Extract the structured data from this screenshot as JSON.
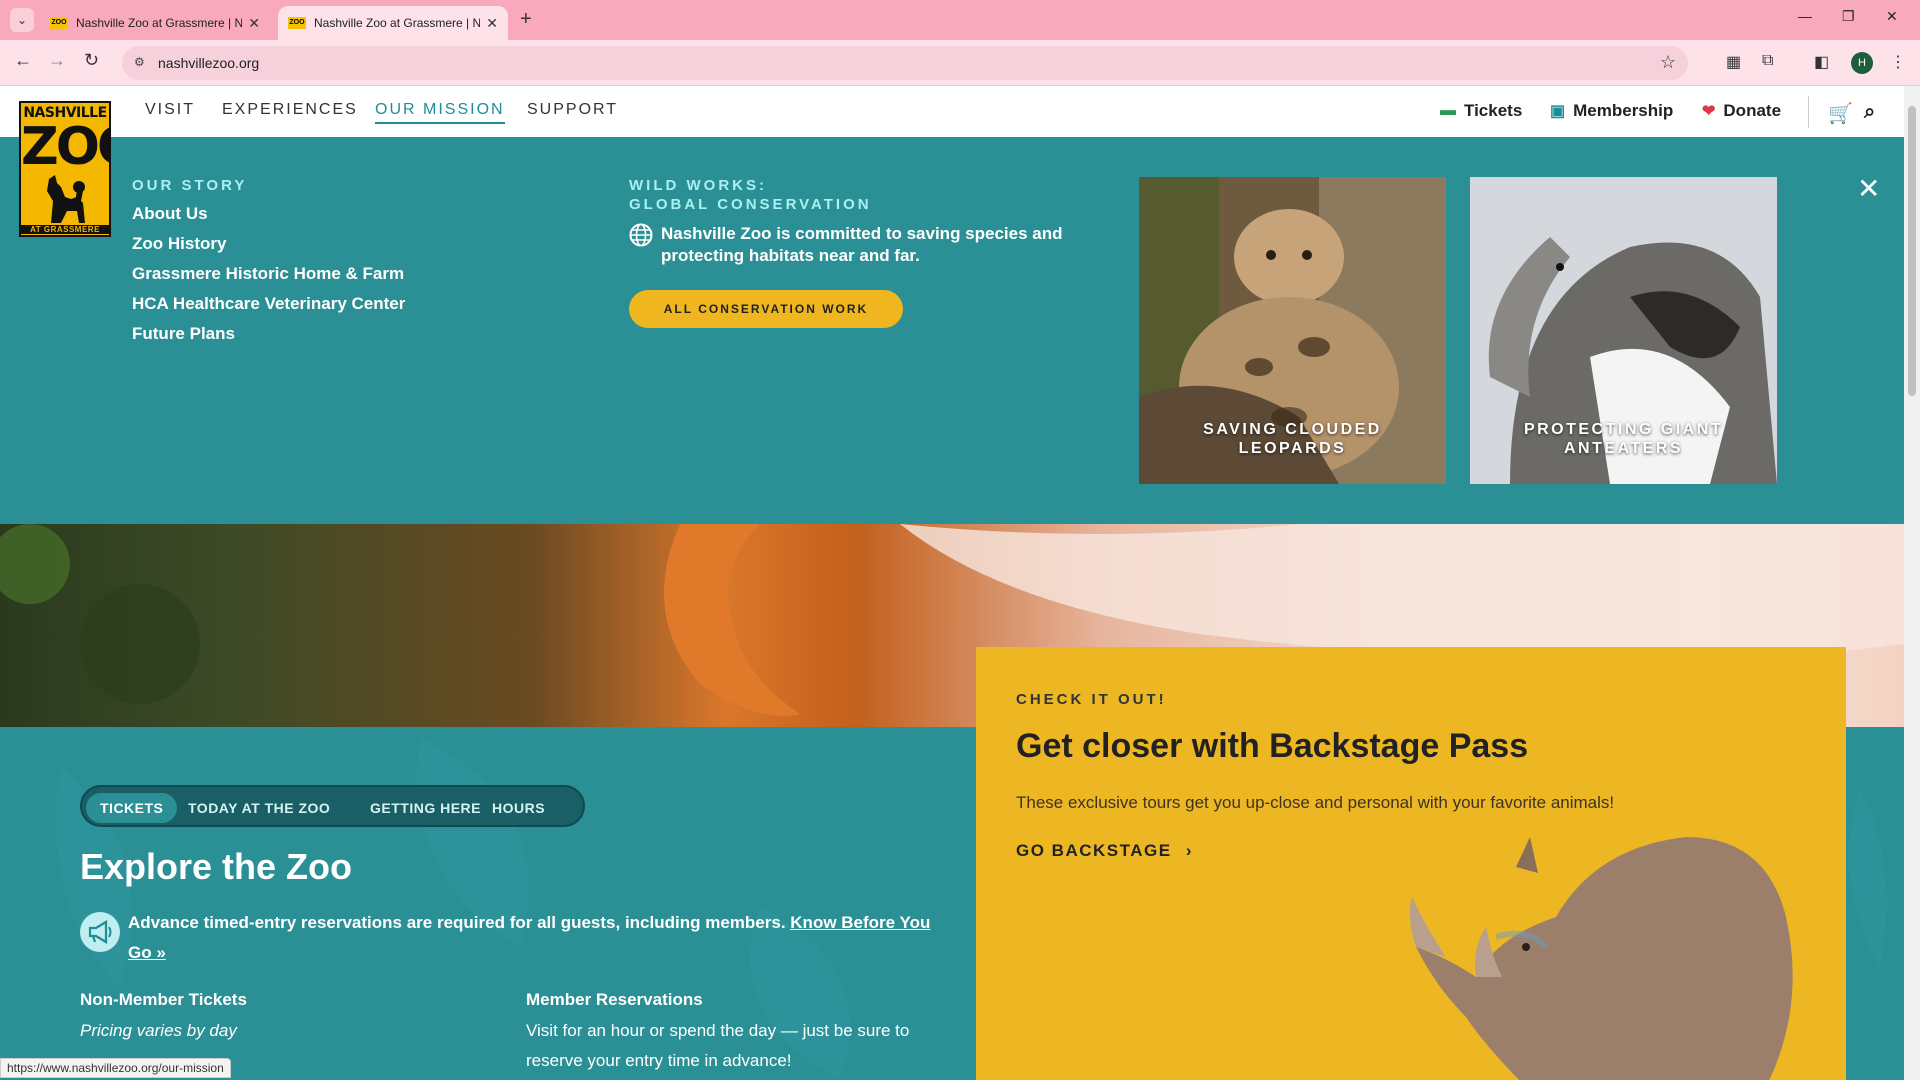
{
  "browser": {
    "tabs": [
      {
        "title": "Nashville Zoo at Grassmere | Na",
        "favicon": "ZOO"
      },
      {
        "title": "Nashville Zoo at Grassmere | Na",
        "favicon": "ZOO"
      }
    ],
    "url": "nashvillezoo.org",
    "profile_initial": "H",
    "status_url": "https://www.nashvillezoo.org/our-mission"
  },
  "logo": {
    "line1": "NASHVILLE",
    "line2": "ZOO",
    "line3": "AT GRASSMERE"
  },
  "nav": {
    "items": [
      "VISIT",
      "EXPERIENCES",
      "OUR MISSION",
      "SUPPORT"
    ],
    "active": "OUR MISSION",
    "tickets": "Tickets",
    "membership": "Membership",
    "donate": "Donate"
  },
  "mega": {
    "story_heading": "OUR STORY",
    "story_links": [
      "About Us",
      "Zoo History",
      "Grassmere Historic Home & Farm",
      "HCA Healthcare Veterinary Center",
      "Future Plans"
    ],
    "wild_heading_1": "WILD WORKS:",
    "wild_heading_2": "GLOBAL CONSERVATION",
    "wild_text": "Nashville Zoo is committed to saving species and protecting habitats near and far.",
    "button": "ALL CONSERVATION WORK",
    "cards": [
      {
        "line1": "SAVING CLOUDED",
        "line2": "LEOPARDS"
      },
      {
        "line1": "PROTECTING GIANT",
        "line2": "ANTEATERS"
      }
    ]
  },
  "content": {
    "pills": [
      "TICKETS",
      "TODAY AT THE ZOO",
      "GETTING HERE",
      "HOURS"
    ],
    "title": "Explore the Zoo",
    "notice": "Advance timed-entry reservations are required for all guests, including members.",
    "notice_link": "Know Before You Go »",
    "col1_heading": "Non-Member Tickets",
    "col1_text": "Pricing varies by day",
    "col2_heading": "Member Reservations",
    "col2_text": "Visit for an hour or spend the day — just be sure to reserve your entry time in advance!"
  },
  "promo": {
    "kicker": "CHECK IT OUT!",
    "title": "Get closer with Backstage Pass",
    "desc": "These exclusive tours get you up-close and personal with your favorite animals!",
    "cta": "GO BACKSTAGE"
  },
  "colors": {
    "teal": "#2b8f96",
    "yellow": "#edb724",
    "accent_text": "#a9f0f3",
    "tab_pink": "#f8a9bb"
  }
}
